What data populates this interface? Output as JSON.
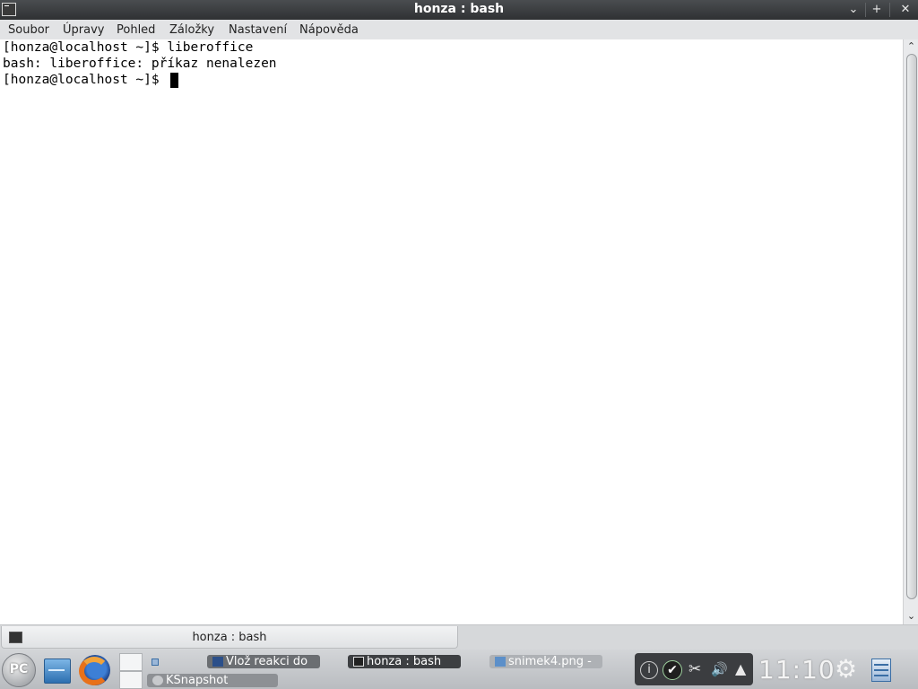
{
  "window": {
    "title": "honza : bash",
    "buttons": {
      "minimize": "⌄",
      "maximize": "+",
      "close": "✕"
    }
  },
  "menubar": {
    "items": [
      "Soubor",
      "Úpravy",
      "Pohled",
      "Záložky",
      "Nastavení",
      "Nápověda"
    ]
  },
  "terminal": {
    "lines": [
      "[honza@localhost ~]$ liberoffice",
      "bash: liberoffice: příkaz nenalezen",
      "[honza@localhost ~]$ "
    ]
  },
  "scrollbar": {
    "up": "⌃",
    "down": "⌄"
  },
  "tabbar": {
    "tab_label": "honza : bash"
  },
  "taskbar": {
    "start_label": "PC",
    "tasks": [
      {
        "label": "Vlož reakci do",
        "icon": "browser-icon"
      },
      {
        "label": "honza : bash",
        "icon": "terminal-icon"
      },
      {
        "label": "snimek4.png -",
        "icon": "image-icon"
      },
      {
        "label": "KSnapshot",
        "icon": "ksnapshot-icon"
      }
    ],
    "tray": {
      "info": "i",
      "check": "✔",
      "scissors": "✂",
      "volume": "🔊",
      "arrow": "▲"
    },
    "clock": "11:10",
    "gear": "⚙"
  }
}
